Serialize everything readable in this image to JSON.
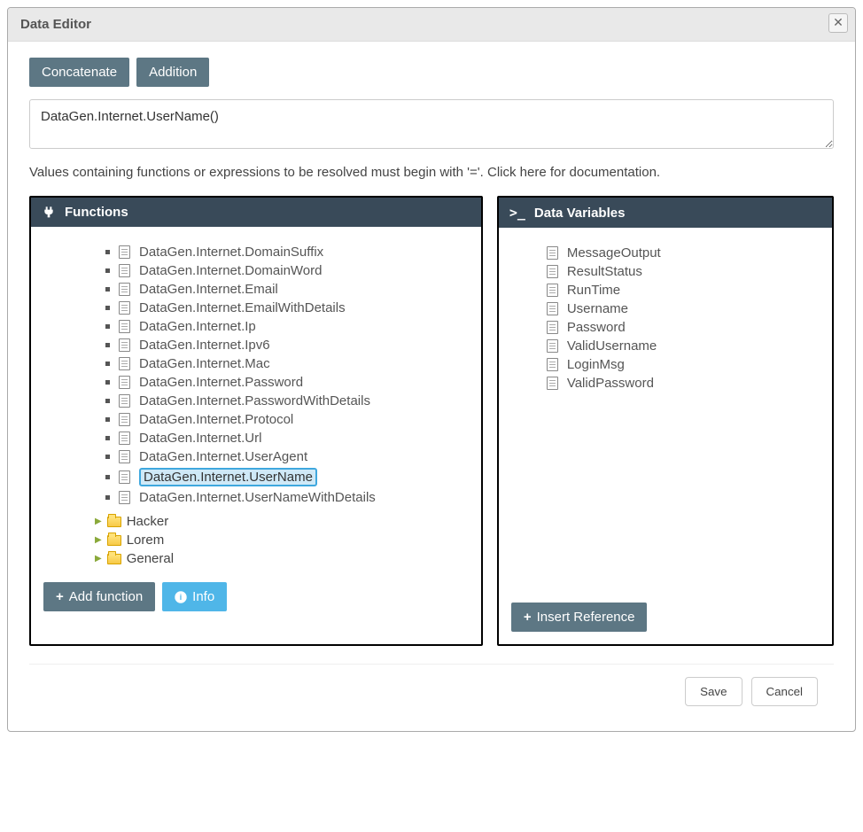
{
  "dialog": {
    "title": "Data Editor"
  },
  "toolbar": {
    "concat": "Concatenate",
    "add": "Addition"
  },
  "expression": {
    "value": "DataGen.Internet.UserName()"
  },
  "hint": "Values containing functions or expressions to be resolved must begin with '='. Click here for documentation.",
  "functions": {
    "header": "Functions",
    "items": [
      "DataGen.Internet.DomainSuffix",
      "DataGen.Internet.DomainWord",
      "DataGen.Internet.Email",
      "DataGen.Internet.EmailWithDetails",
      "DataGen.Internet.Ip",
      "DataGen.Internet.Ipv6",
      "DataGen.Internet.Mac",
      "DataGen.Internet.Password",
      "DataGen.Internet.PasswordWithDetails",
      "DataGen.Internet.Protocol",
      "DataGen.Internet.Url",
      "DataGen.Internet.UserAgent",
      "DataGen.Internet.UserName",
      "DataGen.Internet.UserNameWithDetails"
    ],
    "selected_index": 12,
    "folders": [
      "Hacker",
      "Lorem",
      "General"
    ],
    "add_button": "Add function",
    "info_button": "Info"
  },
  "variables": {
    "header": "Data Variables",
    "items": [
      "MessageOutput",
      "ResultStatus",
      "RunTime",
      "Username",
      "Password",
      "ValidUsername",
      "LoginMsg",
      "ValidPassword"
    ],
    "insert_button": "Insert Reference"
  },
  "footer": {
    "save": "Save",
    "cancel": "Cancel"
  }
}
